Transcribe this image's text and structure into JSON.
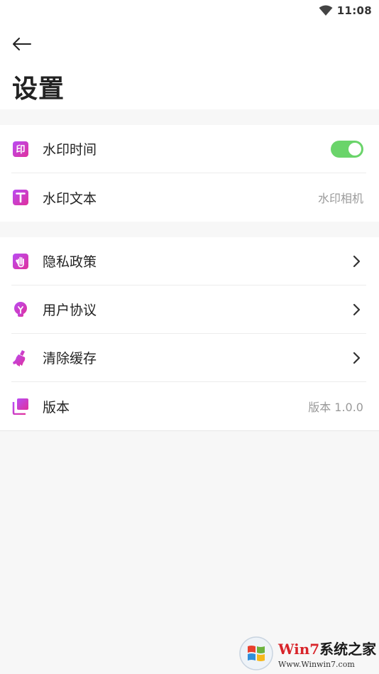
{
  "status_bar": {
    "time": "11:08"
  },
  "header": {
    "title": "设置"
  },
  "group1": {
    "items": [
      {
        "label": "水印时间",
        "type": "toggle",
        "toggle_on": true
      },
      {
        "label": "水印文本",
        "type": "value",
        "value": "水印相机"
      }
    ]
  },
  "group2": {
    "items": [
      {
        "label": "隐私政策",
        "type": "link"
      },
      {
        "label": "用户协议",
        "type": "link"
      },
      {
        "label": "清除缓存",
        "type": "link"
      },
      {
        "label": "版本",
        "type": "value",
        "value": "版本 1.0.0"
      }
    ]
  },
  "watermark": {
    "brand_prefix": "Win7",
    "brand_suffix": "系统之家",
    "url": "Www.Winwin7.com"
  },
  "colors": {
    "accent_gradient_start": "#b84cf5",
    "accent_gradient_end": "#e0309b",
    "toggle_on": "#6ad46a"
  }
}
